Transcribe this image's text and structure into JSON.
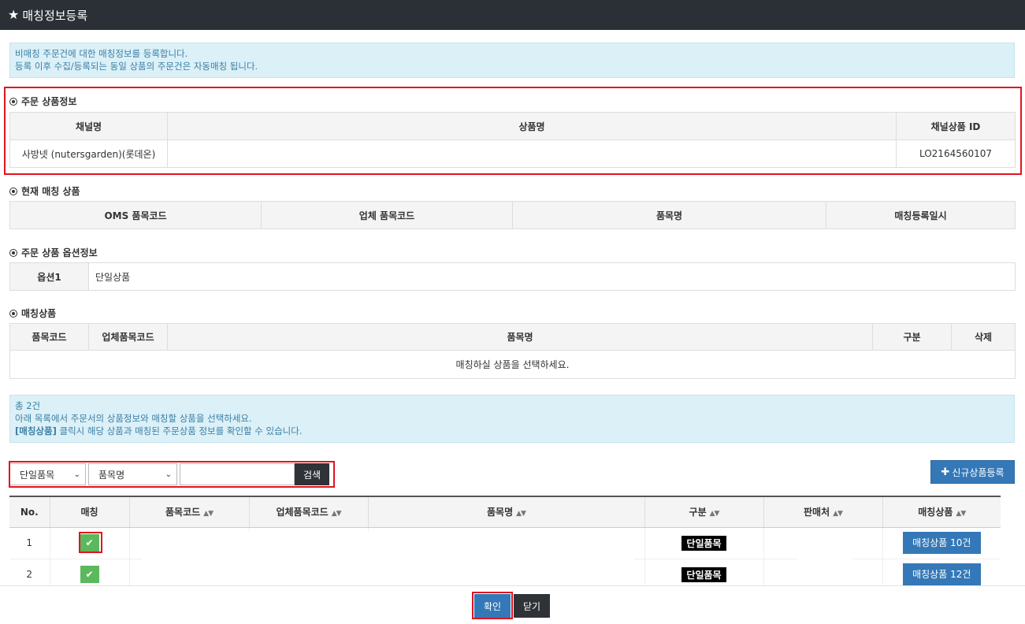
{
  "window": {
    "title": "매칭정보등록"
  },
  "notice1": {
    "line1": "비매칭 주문건에 대한 매칭정보를 등록합니다.",
    "line2": "등록 이후 수집/등록되는 동일 상품의 주문건은 자동매칭 됩니다."
  },
  "order_product": {
    "title": "주문 상품정보",
    "headers": [
      "채널명",
      "상품명",
      "채널상품 ID"
    ],
    "row": [
      "사방넷 (nutersgarden)(롯데온)",
      "",
      "LO2164560107"
    ]
  },
  "current_match": {
    "title": "현재 매칭 상품",
    "headers": [
      "OMS 품목코드",
      "업체 품목코드",
      "품목명",
      "매칭등록일시"
    ]
  },
  "order_option": {
    "title": "주문 상품 옵션정보",
    "label": "옵션1",
    "value": "단일상품"
  },
  "match_products": {
    "title": "매칭상품",
    "headers": [
      "품목코드",
      "업체품목코드",
      "품목명",
      "구분",
      "삭제"
    ],
    "empty": "매칭하실 상품을 선택하세요."
  },
  "notice2": {
    "total": "총 2건",
    "line2": "아래 목록에서 주문서의 상품정보와 매칭할 상품을 선택하세요.",
    "line3_bold": "[매칭상품]",
    "line3_rest": " 클릭시 해당 상품과 매칭된 주문상품 정보를 확인할 수 있습니다."
  },
  "search": {
    "type_value": "단일품목",
    "field_value": "품목명",
    "input_value": "",
    "button": "검색"
  },
  "new_product_button": "신규상품등록",
  "list": {
    "headers": [
      "No.",
      "매칭",
      "품목코드",
      "업체품목코드",
      "품목명",
      "구분",
      "판매처",
      "매칭상품"
    ],
    "rows": [
      {
        "no": "1",
        "type": "단일품목",
        "match_btn": "매칭상품 10건"
      },
      {
        "no": "2",
        "type": "단일품목",
        "match_btn": "매칭상품 12건"
      }
    ]
  },
  "footer": {
    "ok": "확인",
    "close": "닫기"
  },
  "colors": {
    "titlebar": "#2b3036",
    "primary": "#3478b7",
    "highlight": "#e1141e",
    "check": "#5cb85c"
  }
}
